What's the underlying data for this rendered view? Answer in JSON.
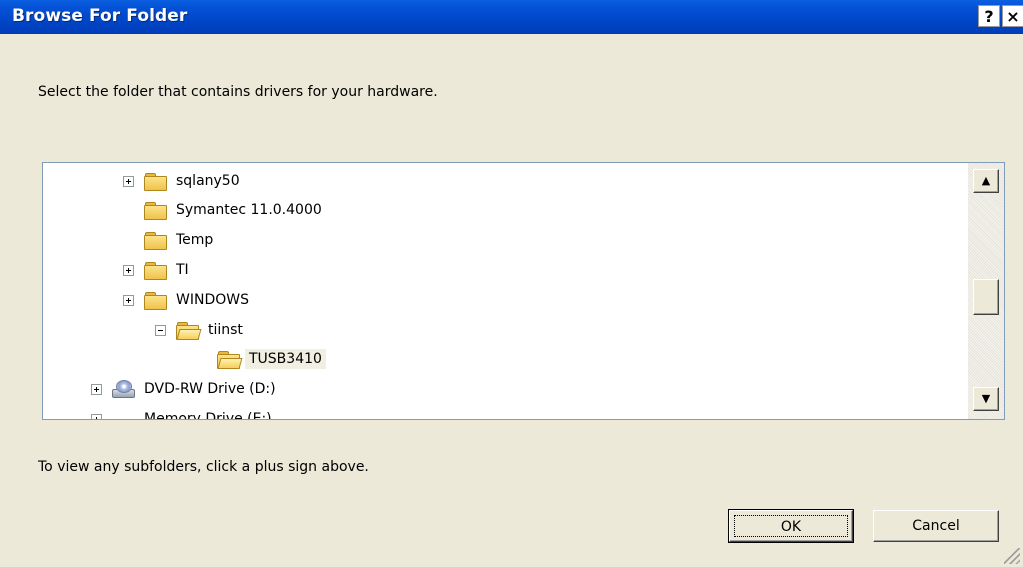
{
  "window": {
    "title": "Browse For Folder",
    "help_glyph": "?",
    "close_glyph": "×"
  },
  "instruction": "Select the folder that contains drivers for your hardware.",
  "tree": {
    "items": [
      {
        "label": "sqlany50",
        "icon": "folder-icon",
        "expander": "plus",
        "selected": false
      },
      {
        "label": "Symantec 11.0.4000",
        "icon": "folder-icon",
        "expander": "none",
        "selected": false
      },
      {
        "label": "Temp",
        "icon": "folder-icon",
        "expander": "none",
        "selected": false
      },
      {
        "label": "TI",
        "icon": "folder-icon",
        "expander": "plus",
        "selected": false
      },
      {
        "label": "WINDOWS",
        "icon": "folder-icon",
        "expander": "plus",
        "selected": false
      },
      {
        "label": "tiinst",
        "icon": "folder-open-icon",
        "expander": "minus",
        "selected": false
      },
      {
        "label": "TUSB3410",
        "icon": "folder-open-icon",
        "expander": "none",
        "selected": true
      },
      {
        "label": "DVD-RW Drive (D:)",
        "icon": "dvd-drive-icon",
        "expander": "plus",
        "selected": false
      },
      {
        "label": "Memory Drive (E:)",
        "icon": "drive-icon",
        "expander": "plus",
        "selected": false
      }
    ]
  },
  "scrollbar": {
    "up_glyph": "▲",
    "down_glyph": "▼"
  },
  "hint": "To view any subfolders, click a plus sign above.",
  "buttons": {
    "ok": "OK",
    "cancel": "Cancel"
  }
}
